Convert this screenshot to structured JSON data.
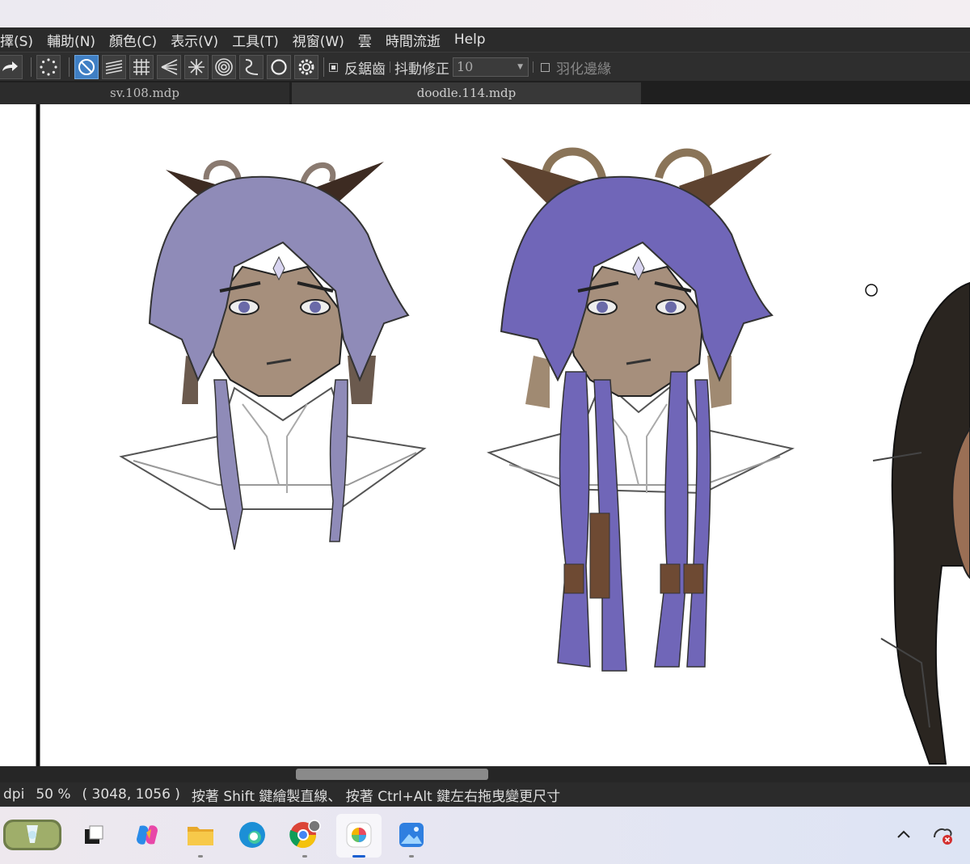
{
  "menu": [
    "擇(S)",
    "輔助(N)",
    "顏色(C)",
    "表示(V)",
    "工具(T)",
    "視窗(W)",
    "雲",
    "時間流逝",
    "Help"
  ],
  "toolbar": {
    "antialias_label": "反鋸齒",
    "stabilizer_label": "抖動修正",
    "stabilizer_value": "10",
    "feather_label": "羽化邊緣",
    "tools": [
      "brush-snap-off-icon",
      "parallel-lines-icon",
      "grid-icon",
      "vanishing-point-icon",
      "radial-icon",
      "concentric-icon",
      "curve-icon",
      "circle-icon",
      "gear-icon"
    ]
  },
  "tabs": [
    "sv.108.mdp",
    "doodle.114.mdp"
  ],
  "status": {
    "dpi": "dpi",
    "zoom": "50 %",
    "coords": "( 3048, 1056 )",
    "hint": "按著 Shift 鍵繪製直線、 按著 Ctrl+Alt 鍵左右拖曳變更尺寸"
  },
  "taskbar": {
    "apps": [
      "widgets-icon",
      "task-view-icon",
      "copilot-icon",
      "file-explorer-icon",
      "edge-icon",
      "chrome-icon",
      "medibang-icon",
      "photos-icon"
    ],
    "tray": [
      "chevron-up-icon",
      "network-error-icon"
    ]
  }
}
